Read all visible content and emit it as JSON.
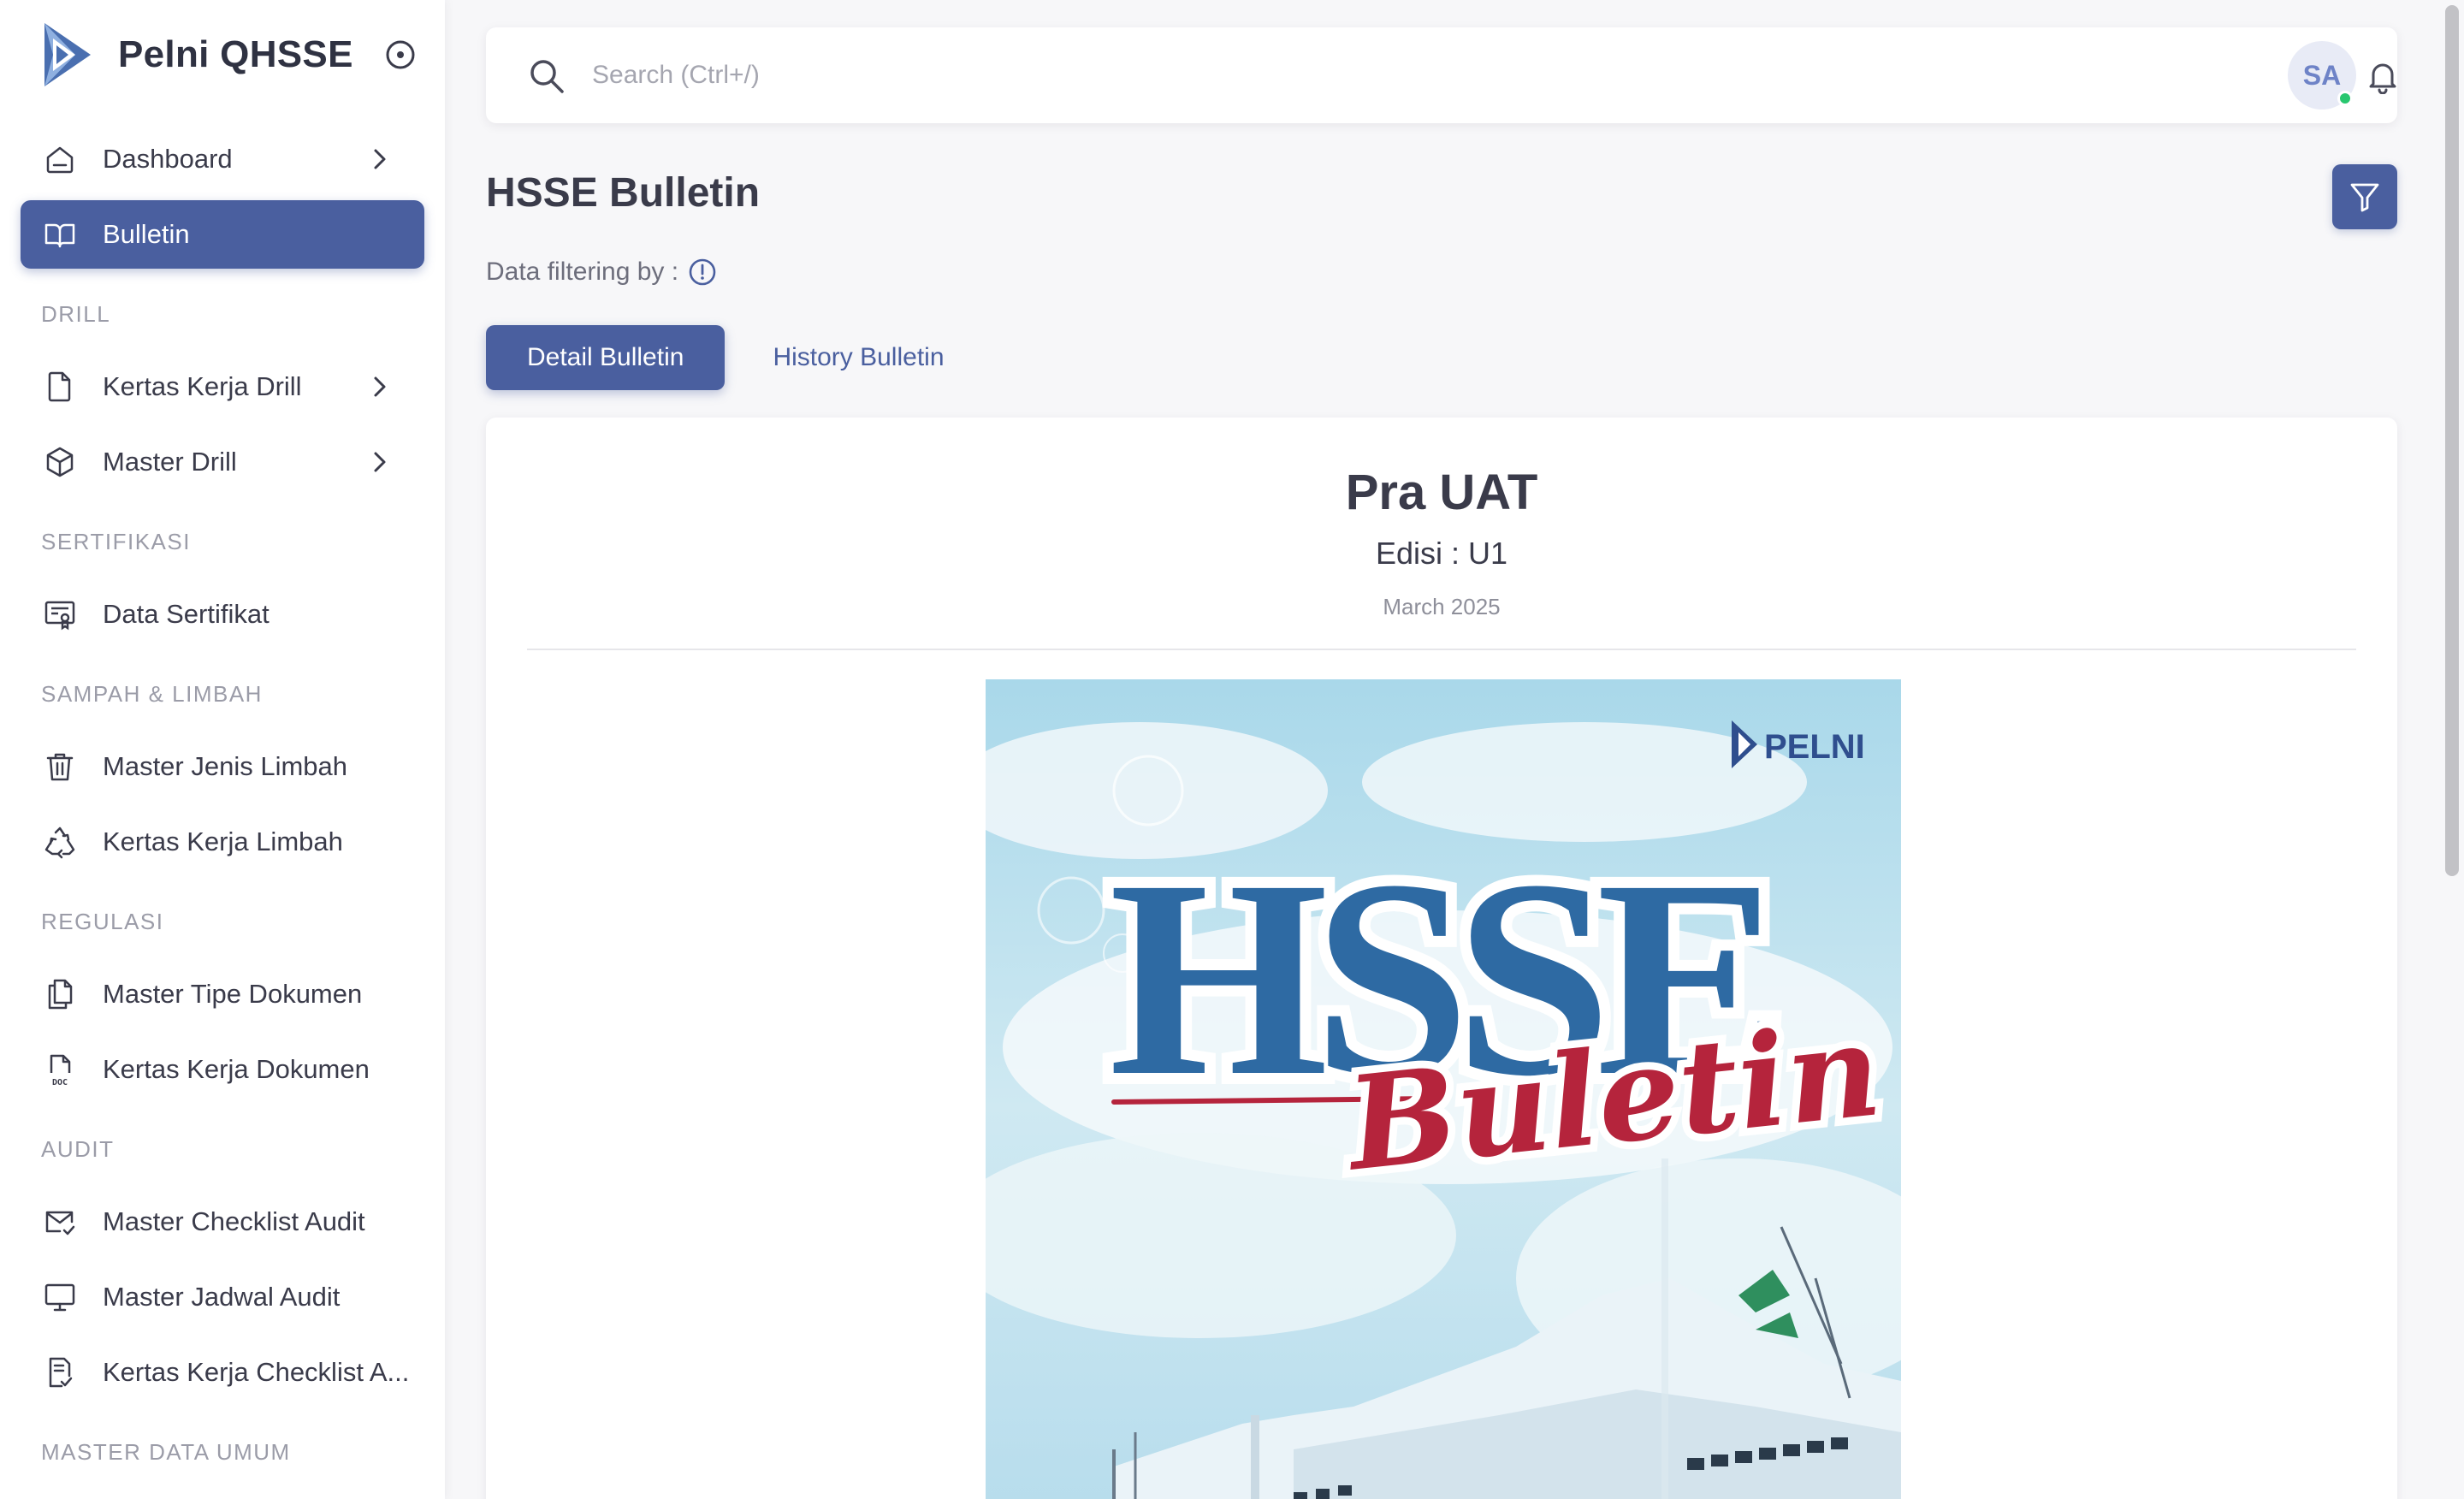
{
  "app": {
    "name": "Pelni QHSSE"
  },
  "sidebar": {
    "items": [
      {
        "label": "Dashboard"
      },
      {
        "label": "Bulletin"
      },
      {
        "label": "Kertas Kerja Drill"
      },
      {
        "label": "Master Drill"
      },
      {
        "label": "Data Sertifikat"
      },
      {
        "label": "Master Jenis Limbah"
      },
      {
        "label": "Kertas Kerja Limbah"
      },
      {
        "label": "Master Tipe Dokumen"
      },
      {
        "label": "Kertas Kerja Dokumen"
      },
      {
        "label": "Master Checklist Audit"
      },
      {
        "label": "Master Jadwal Audit"
      },
      {
        "label": "Kertas Kerja Checklist A..."
      }
    ],
    "sections": [
      "DRILL",
      "SERTIFIKASI",
      "SAMPAH & LIMBAH",
      "REGULASI",
      "AUDIT",
      "MASTER DATA UMUM"
    ],
    "active_color": "#4a5f9f"
  },
  "search": {
    "placeholder": "Search (Ctrl+/)",
    "value": ""
  },
  "user": {
    "initials": "SA",
    "status_color": "#28c76f"
  },
  "page": {
    "title": "HSSE Bulletin",
    "filter_label": "Data filtering by :",
    "tabs": [
      "Detail Bulletin",
      "History Bulletin"
    ]
  },
  "bulletin": {
    "title": "Pra UAT",
    "edition": "Edisi : U1",
    "date": "March 2025",
    "cover": {
      "brand": "PELNI",
      "headline": "HSSE",
      "script": "Buletin"
    }
  }
}
